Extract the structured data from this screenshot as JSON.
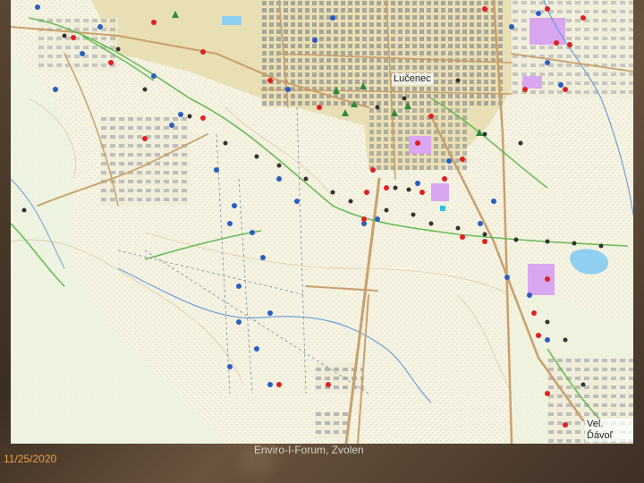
{
  "slide": {
    "date": "11/25/2020",
    "title": "Enviro-I-Forum, Zvolen"
  },
  "map": {
    "labels": {
      "town": "Lučenec",
      "village": "Vel. Ďávoľ"
    },
    "colors": {
      "background": "#f6f3e4",
      "roads": "#c9a06b",
      "urban": "#e9dfb4",
      "industrial": "#d9a6f0",
      "water": "#8fd0f0",
      "stream": "#6aa0d8",
      "red_points": "#e02020",
      "blue_points": "#2a5ec0",
      "dark_points": "#333333",
      "green_lines": "#58b848"
    }
  }
}
